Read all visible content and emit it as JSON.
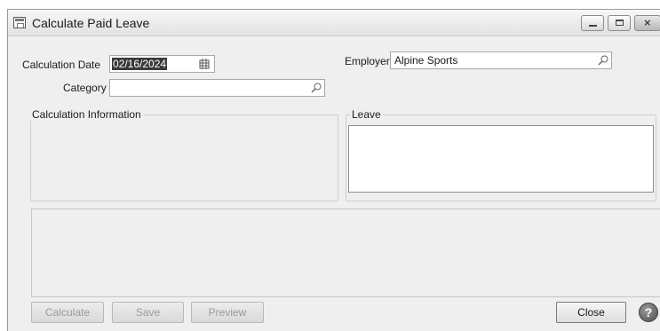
{
  "window": {
    "title": "Calculate Paid Leave",
    "controls": {
      "minimize_icon": "minimize-icon",
      "maximize_icon": "maximize-icon",
      "close_glyph": "×"
    }
  },
  "form": {
    "calculation_date_label": "Calculation Date",
    "calculation_date_value": "02/16/2024",
    "category_label": "Category",
    "category_value": "",
    "employer_label": "Employer",
    "employer_value": "Alpine Sports"
  },
  "groups": {
    "calculation_info_title": "Calculation Information",
    "leave_title": "Leave"
  },
  "buttons": {
    "calculate": "Calculate",
    "save": "Save",
    "preview": "Preview",
    "close": "Close",
    "help_glyph": "?"
  },
  "icons": {
    "calendar": "calendar-icon",
    "search": "search-icon",
    "help": "help-icon",
    "app": "app-icon"
  }
}
